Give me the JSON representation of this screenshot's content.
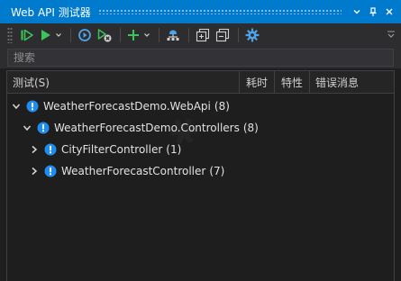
{
  "window": {
    "title": "Web API 测试器"
  },
  "titlebar": {
    "dropdown_icon": "chevron-down-icon",
    "pin_icon": "pin-icon",
    "close_icon": "close-icon"
  },
  "toolbar": {
    "buttons": [
      {
        "name": "run-all-icon",
        "color": "#3bc65a"
      },
      {
        "name": "run-icon",
        "color": "#3bc65a"
      },
      {
        "name": "refresh-icon",
        "color": "#4fa3e8"
      },
      {
        "name": "cancel-run-icon",
        "color": "#d0d0d0"
      },
      {
        "name": "add-icon",
        "color": "#3bc65a"
      },
      {
        "name": "network-icon",
        "color": "#4fa3e8"
      },
      {
        "name": "expand-all-icon",
        "color": "#d0d0d0"
      },
      {
        "name": "collapse-all-icon",
        "color": "#d0d0d0"
      },
      {
        "name": "gear-icon",
        "color": "#4fa3e8"
      }
    ]
  },
  "search": {
    "placeholder": "搜索"
  },
  "columns": {
    "test": "测试(S)",
    "duration": "耗时",
    "traits": "特性",
    "error": "错误消息"
  },
  "tree": {
    "status_color": "#1e8cf0",
    "items": [
      {
        "label": "WeatherForecastDemo.WebApi",
        "count": "(8)",
        "expanded": true,
        "level": 0
      },
      {
        "label": "WeatherForecastDemo.Controllers",
        "count": "(8)",
        "expanded": true,
        "level": 1
      },
      {
        "label": "CityFilterController",
        "count": "(1)",
        "expanded": false,
        "level": 2
      },
      {
        "label": "WeatherForecastController",
        "count": "(7)",
        "expanded": false,
        "level": 2
      }
    ]
  }
}
